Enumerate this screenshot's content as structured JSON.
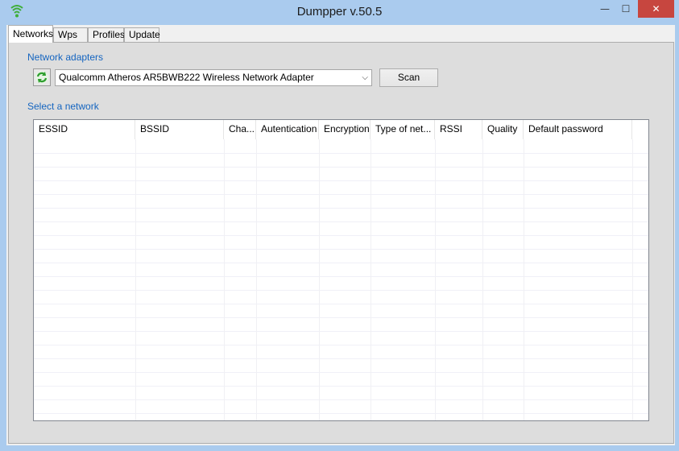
{
  "window": {
    "title": "Dumpper v.50.5",
    "min_glyph": "—",
    "max_glyph": "☐",
    "close_glyph": "✕",
    "app_icon": "wifi-signal-icon"
  },
  "tabs": [
    {
      "label": "Networks",
      "active": true
    },
    {
      "label": "Wps",
      "active": false
    },
    {
      "label": "Profiles",
      "active": false
    },
    {
      "label": "Update",
      "active": false
    }
  ],
  "adapters": {
    "section_label": "Network adapters",
    "refresh_icon": "refresh-icon",
    "selected": "Qualcomm Atheros AR5BWB222 Wireless Network Adapter",
    "dropdown_glyph": "⌵",
    "scan_label": "Scan"
  },
  "networks": {
    "section_label": "Select a network",
    "columns": [
      "ESSID",
      "BSSID",
      "Cha...",
      "Autentication",
      "Encryption",
      "Type of net...",
      "RSSI",
      "Quality",
      "Default password",
      ""
    ],
    "rows": []
  },
  "colors": {
    "accent_label": "#1565c0",
    "close_button": "#c7463f",
    "window_frame": "#aacbee"
  }
}
